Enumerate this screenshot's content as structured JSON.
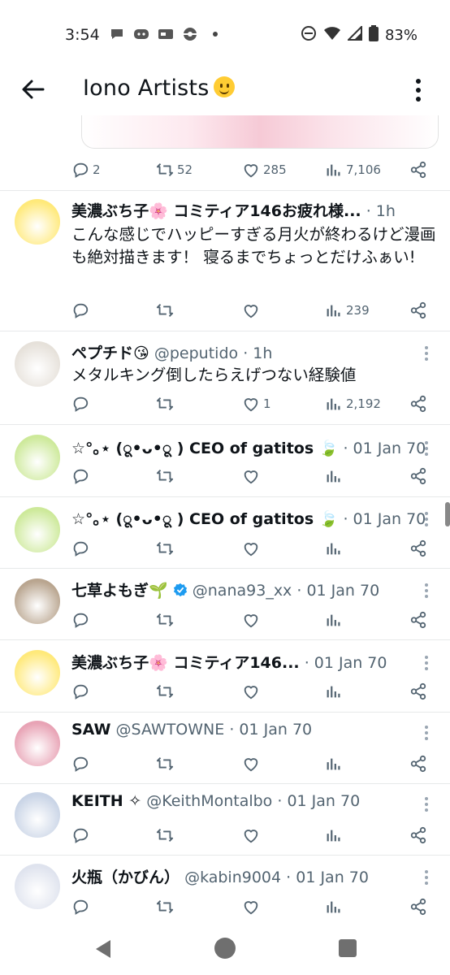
{
  "status_bar": {
    "time": "3:54",
    "battery": "83%"
  },
  "app_bar": {
    "title": "Iono Artists"
  },
  "top_actions": {
    "replies": "2",
    "retweets": "52",
    "likes": "285",
    "views": "7,106"
  },
  "tweets": [
    {
      "name": "美濃ぶち子🌸 コミティア146お疲れ様...",
      "handle": "",
      "time": "· 1h",
      "text": "こんな感じでハッピーすぎる月火が終わるけど漫画も絶対描きます！ 寝るまでちょっとだけふぁい!",
      "replies": "",
      "retweets": "",
      "likes": "",
      "views": "239",
      "avatar_color": "#ffe97a"
    },
    {
      "name": "ペプチド😘",
      "handle": "@peputido",
      "time": "· 1h",
      "text": "メタルキング倒したらえげつない経験値",
      "replies": "",
      "retweets": "",
      "likes": "1",
      "views": "2,192",
      "avatar_color": "#e6e1da"
    },
    {
      "name": "☆°｡⋆ (ू•ᴗ•ू ) CEO of gatitos 🍃",
      "handle": "",
      "time": "· 01 Jan 70",
      "text": "",
      "replies": "",
      "retweets": "",
      "likes": "",
      "views": "",
      "avatar_color": "#cde99a"
    },
    {
      "name": "☆°｡⋆ (ू•ᴗ•ू ) CEO of gatitos 🍃",
      "handle": "",
      "time": "· 01 Jan 70",
      "text": "",
      "replies": "",
      "retweets": "",
      "likes": "",
      "views": "",
      "avatar_color": "#cde99a"
    },
    {
      "name": "七草よもぎ🌱",
      "handle": "@nana93_xx",
      "time": "· 01 Jan 70",
      "text": "",
      "replies": "",
      "retweets": "",
      "likes": "",
      "views": "",
      "avatar_color": "#b9a58f"
    },
    {
      "name": "美濃ぶち子🌸 コミティア146...",
      "handle": "",
      "time": "· 01 Jan 70",
      "text": "",
      "replies": "",
      "retweets": "",
      "likes": "",
      "views": "",
      "avatar_color": "#ffe97a"
    },
    {
      "name": "SAW",
      "handle": "@SAWTOWNE",
      "time": "· 01 Jan 70",
      "text": "",
      "replies": "",
      "retweets": "",
      "likes": "",
      "views": "",
      "avatar_color": "#e8a3b5"
    },
    {
      "name": "KEITH ✧",
      "handle": "@KeithMontalbo",
      "time": "· 01 Jan 70",
      "text": "",
      "replies": "",
      "retweets": "",
      "likes": "",
      "views": "",
      "avatar_color": "#c9d4e6"
    },
    {
      "name": "火瓶（かびん）",
      "handle": "@kabin9004",
      "time": "· 01 Jan 70",
      "text": "",
      "replies": "",
      "retweets": "",
      "likes": "",
      "views": "",
      "avatar_color": "#dfe3ee"
    }
  ]
}
